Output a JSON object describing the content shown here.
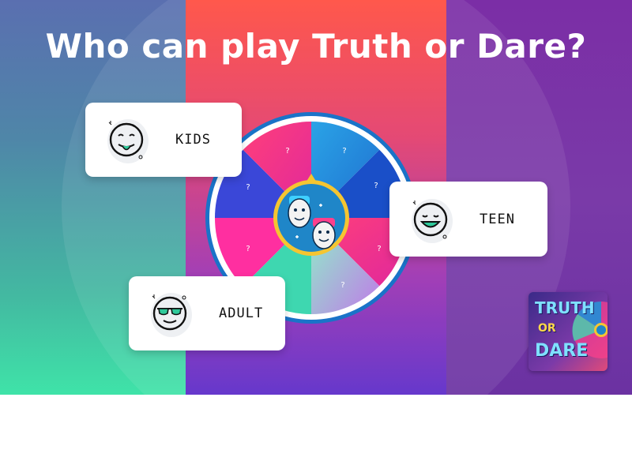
{
  "title": "Who can play Truth or Dare?",
  "options": [
    {
      "label": "KIDS",
      "icon": "tongue-out-face-icon"
    },
    {
      "label": "TEEN",
      "icon": "smiling-face-icon"
    },
    {
      "label": "ADULT",
      "icon": "sunglasses-face-icon"
    }
  ],
  "wheel": {
    "segment_marker": "?",
    "segments": 8
  },
  "logo": {
    "line1": "TRUTH",
    "line2": "OR",
    "line3": "DARE"
  },
  "colors": {
    "wheel_blue": "#1f8fd8",
    "wheel_pink": "#ff2f8c",
    "hub_ring": "#f5c531",
    "card_bg": "#ffffff"
  }
}
